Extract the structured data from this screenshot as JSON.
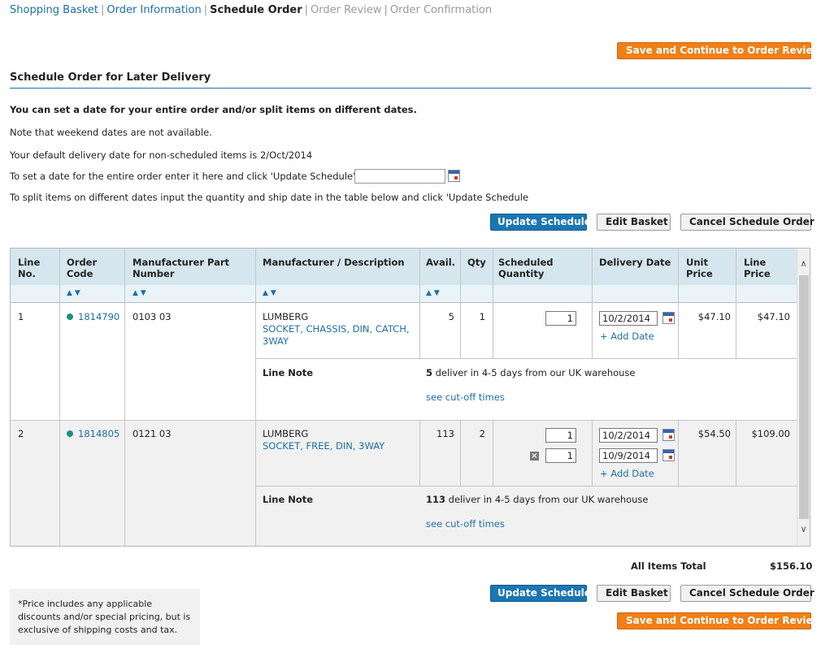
{
  "breadcrumb": {
    "steps": [
      {
        "label": "Shopping Basket"
      },
      {
        "label": "Order Information"
      },
      {
        "label": "Schedule Order"
      },
      {
        "label": "Order Review"
      },
      {
        "label": "Order Confirmation"
      }
    ],
    "separator": "|"
  },
  "actions": {
    "save_continue": "Save and Continue to Order Review",
    "update_schedule": "Update Schedule",
    "edit_basket": "Edit Basket",
    "cancel_schedule": "Cancel Schedule Order"
  },
  "section": {
    "title": "Schedule Order for Later Delivery",
    "intro": "You can set a date for your entire order and/or split items on different dates.",
    "weekend_note": "Note that weekend dates are not available.",
    "default_date": "Your default delivery date for non-scheduled items is 2/Oct/2014",
    "entire_order": "To set a date for the entire order enter it here and click 'Update Schedule'.",
    "entire_order_value": "",
    "split_note": "To split items on different dates input the quantity and ship date in the table below and click 'Update Schedule"
  },
  "table": {
    "headers": {
      "line_no": [
        "Line",
        "No."
      ],
      "order_code": [
        "Order",
        "Code"
      ],
      "mpn": [
        "Manufacturer Part",
        "Number"
      ],
      "desc": "Manufacturer / Description",
      "avail": "Avail.",
      "qty": "Qty",
      "sched_qty": [
        "Scheduled",
        "Quantity"
      ],
      "delivery": "Delivery Date",
      "unit_price": [
        "Unit",
        "Price"
      ],
      "line_price": [
        "Line",
        "Price"
      ]
    },
    "sort_icon": "▲▼",
    "add_date": "+ Add Date",
    "line_note_label": "Line Note",
    "cutoff": "see cut-off times",
    "remove_icon": "×",
    "rows": [
      {
        "line": "1",
        "code": "1814790",
        "mpn": "0103 03",
        "manufacturer": "LUMBERG",
        "description": [
          "SOCKET, CHASSIS, DIN, CATCH,",
          "3WAY"
        ],
        "avail": "5",
        "qty": "1",
        "schedule": [
          {
            "qty": "1",
            "date": "10/2/2014"
          }
        ],
        "unit_price": "$47.10",
        "line_price": "$47.10",
        "note_qty": "5",
        "note_text": " deliver in 4-5 days from our UK warehouse"
      },
      {
        "line": "2",
        "code": "1814805",
        "mpn": "0121 03",
        "manufacturer": "LUMBERG",
        "description": [
          "SOCKET, FREE, DIN, 3WAY"
        ],
        "avail": "113",
        "qty": "2",
        "schedule": [
          {
            "qty": "1",
            "date": "10/2/2014"
          },
          {
            "qty": "1",
            "date": "10/9/2014"
          }
        ],
        "unit_price": "$54.50",
        "line_price": "$109.00",
        "note_qty": "113",
        "note_text": " deliver in 4-5 days from our UK warehouse"
      }
    ]
  },
  "totals": {
    "label": "All Items Total",
    "value": "$156.10"
  },
  "footnote": "*Price includes any applicable discounts and/or special pricing, but is exclusive of shipping costs and tax.",
  "colors": {
    "link": "#1f6fa6",
    "orange_button": "#f07f16",
    "blue_button": "#1a76b3",
    "header_bg": "#d6e6ef",
    "stock_dot": "#1a8f8a"
  }
}
